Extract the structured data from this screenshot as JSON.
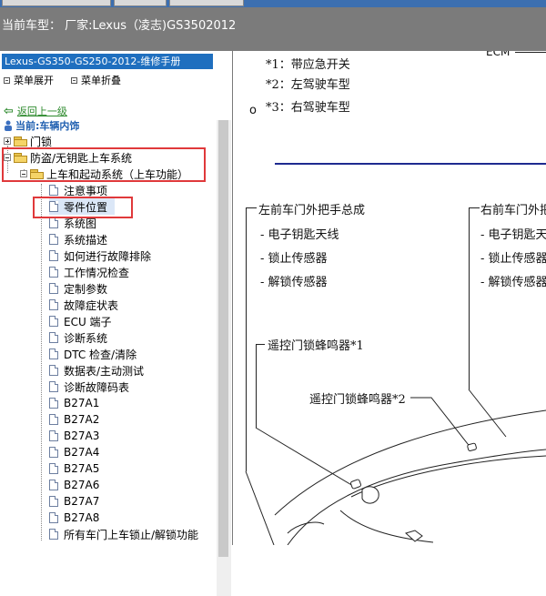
{
  "app": {
    "current_model_label": "当前车型：  厂家:Lexus（凌志)GS3502012"
  },
  "sidebar": {
    "manual_title": "Lexus-GS350-GS250-2012-维修手册",
    "expand_menu": "菜单展开",
    "collapse_menu": "菜单折叠",
    "back_link": "返回上一级",
    "current_path": "当前:车辆内饰",
    "tree": [
      {
        "label": "门锁",
        "type": "folder",
        "expanded": false
      },
      {
        "label": "防盗/无钥匙上车系统",
        "type": "folder",
        "expanded": true
      },
      {
        "label": "上车和起动系统（上车功能）",
        "type": "folder",
        "expanded": true
      },
      {
        "label": "注意事项",
        "type": "doc"
      },
      {
        "label": "零件位置",
        "type": "doc",
        "selected": true
      },
      {
        "label": "系统图",
        "type": "doc"
      },
      {
        "label": "系统描述",
        "type": "doc"
      },
      {
        "label": "如何进行故障排除",
        "type": "doc"
      },
      {
        "label": "工作情况检查",
        "type": "doc"
      },
      {
        "label": "定制参数",
        "type": "doc"
      },
      {
        "label": "故障症状表",
        "type": "doc"
      },
      {
        "label": "ECU 端子",
        "type": "doc"
      },
      {
        "label": "诊断系统",
        "type": "doc"
      },
      {
        "label": "DTC 检查/清除",
        "type": "doc"
      },
      {
        "label": "数据表/主动测试",
        "type": "doc"
      },
      {
        "label": "诊断故障码表",
        "type": "doc"
      },
      {
        "label": "B27A1",
        "type": "doc"
      },
      {
        "label": "B27A2",
        "type": "doc"
      },
      {
        "label": "B27A3",
        "type": "doc"
      },
      {
        "label": "B27A4",
        "type": "doc"
      },
      {
        "label": "B27A5",
        "type": "doc"
      },
      {
        "label": "B27A6",
        "type": "doc"
      },
      {
        "label": "B27A7",
        "type": "doc"
      },
      {
        "label": "B27A8",
        "type": "doc"
      },
      {
        "label": "所有车门上车锁止/解锁功能",
        "type": "doc"
      }
    ]
  },
  "diagram": {
    "ecm": "ECM",
    "notes": [
      "*1：带应急开关",
      "*2：左驾驶车型",
      "*3：右驾驶车型"
    ],
    "stray_char": "o",
    "left_title": "左前车门外把手总成",
    "left_items": [
      "- 电子钥匙天线",
      "- 锁止传感器",
      "- 解锁传感器"
    ],
    "right_title": "右前车门外把",
    "right_items": [
      "- 电子钥匙天",
      "- 锁止传感器",
      "- 解锁传感器"
    ],
    "buzzer1": "遥控门锁蜂鸣器*1",
    "buzzer2": "遥控门锁蜂鸣器*2"
  },
  "colors": {
    "highlight_box": "#e0393b",
    "title_bar": "#1f6fbf",
    "model_bar": "#7b7b7b",
    "rule_line": "#1e2a8f"
  }
}
